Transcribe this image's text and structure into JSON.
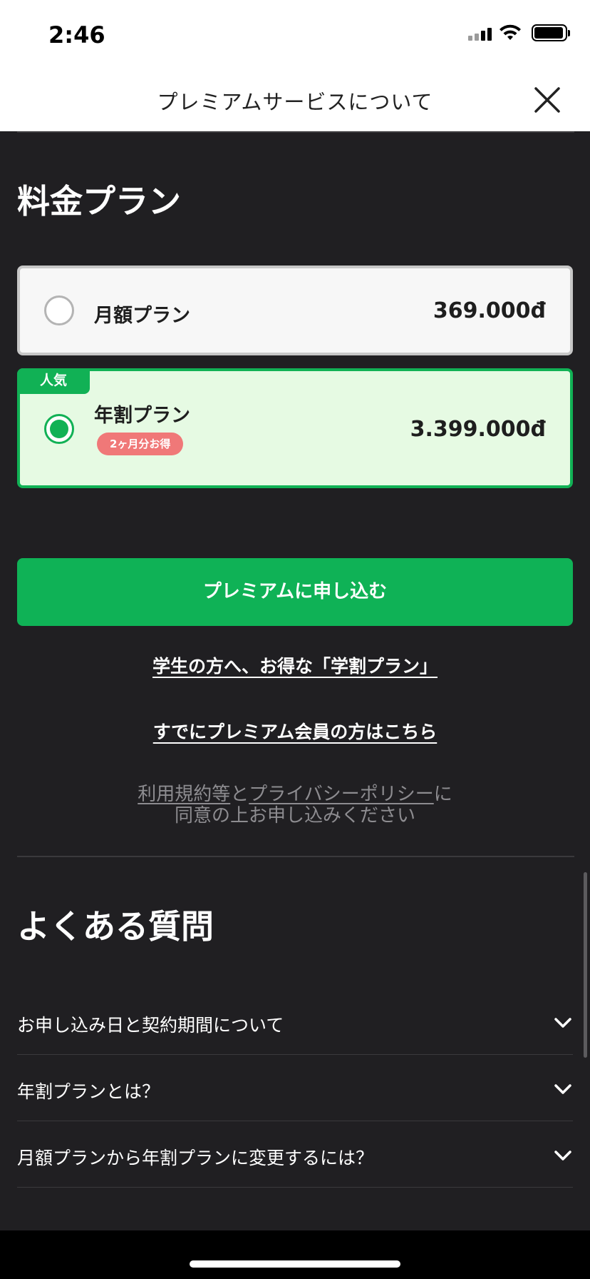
{
  "status_bar": {
    "time": "2:46"
  },
  "header": {
    "title": "プレミアムサービスについて"
  },
  "pricing": {
    "title": "料金プラン",
    "plans": [
      {
        "name": "月額プラン",
        "price": "369.000đ",
        "selected": false
      },
      {
        "name": "年割プラン",
        "price": "3.399.000đ",
        "selected": true,
        "tag": "人気",
        "badge": "2ヶ月分お得"
      }
    ]
  },
  "cta": {
    "label": "プレミアムに申し込む"
  },
  "links": {
    "student": "学生の方へ、お得な「学割プラン」",
    "existing": "すでにプレミアム会員の方はこちら"
  },
  "terms": {
    "terms_link": "利用規約等",
    "and": "と",
    "privacy_link": "プライバシーポリシー",
    "particle": "に",
    "line2": "同意の上お申し込みください"
  },
  "faq": {
    "title": "よくある質問",
    "items": [
      {
        "label": "お申し込み日と契約期間について"
      },
      {
        "label": "年割プランとは？"
      },
      {
        "label": "月額プランから年割プランに変更するには？"
      }
    ]
  },
  "colors": {
    "background": "#201f22",
    "accent_green": "#0fb256",
    "selected_card": "#e6fae3",
    "badge_red": "#f07878"
  }
}
